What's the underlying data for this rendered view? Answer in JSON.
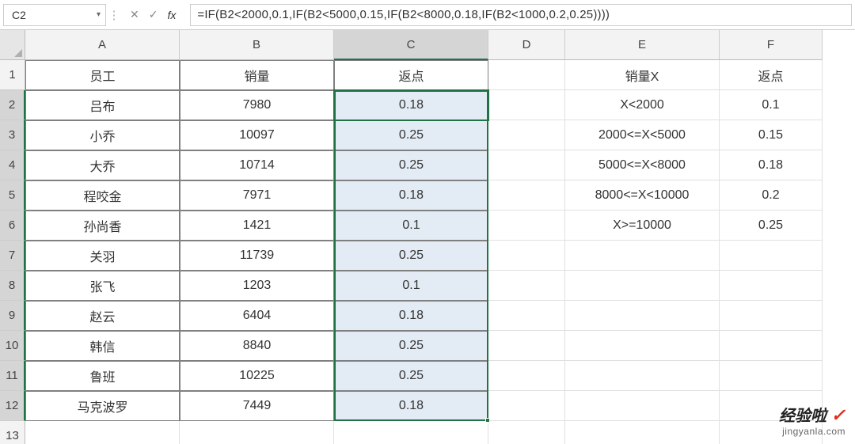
{
  "name_box": "C2",
  "formula": "=IF(B2<2000,0.1,IF(B2<5000,0.15,IF(B2<8000,0.18,IF(B2<1000,0.2,0.25))))",
  "columns": [
    "A",
    "B",
    "C",
    "D",
    "E",
    "F"
  ],
  "rows": [
    "1",
    "2",
    "3",
    "4",
    "5",
    "6",
    "7",
    "8",
    "9",
    "10",
    "11",
    "12",
    "13"
  ],
  "main_table": {
    "header": {
      "A": "员工",
      "B": "销量",
      "C": "返点"
    },
    "data": [
      {
        "A": "吕布",
        "B": "7980",
        "C": "0.18"
      },
      {
        "A": "小乔",
        "B": "10097",
        "C": "0.25"
      },
      {
        "A": "大乔",
        "B": "10714",
        "C": "0.25"
      },
      {
        "A": "程咬金",
        "B": "7971",
        "C": "0.18"
      },
      {
        "A": "孙尚香",
        "B": "1421",
        "C": "0.1"
      },
      {
        "A": "关羽",
        "B": "11739",
        "C": "0.25"
      },
      {
        "A": "张飞",
        "B": "1203",
        "C": "0.1"
      },
      {
        "A": "赵云",
        "B": "6404",
        "C": "0.18"
      },
      {
        "A": "韩信",
        "B": "8840",
        "C": "0.25"
      },
      {
        "A": "鲁班",
        "B": "10225",
        "C": "0.25"
      },
      {
        "A": "马克波罗",
        "B": "7449",
        "C": "0.18"
      }
    ]
  },
  "lookup_table": {
    "header": {
      "E": "销量X",
      "F": "返点"
    },
    "data": [
      {
        "E": "X<2000",
        "F": "0.1"
      },
      {
        "E": "2000<=X<5000",
        "F": "0.15"
      },
      {
        "E": "5000<=X<8000",
        "F": "0.18"
      },
      {
        "E": "8000<=X<10000",
        "F": "0.2"
      },
      {
        "E": "X>=10000",
        "F": "0.25"
      }
    ]
  },
  "active_cell": "C2",
  "watermark": {
    "line1": "经验啦",
    "check": "✓",
    "line2": "jingyanla.com"
  }
}
